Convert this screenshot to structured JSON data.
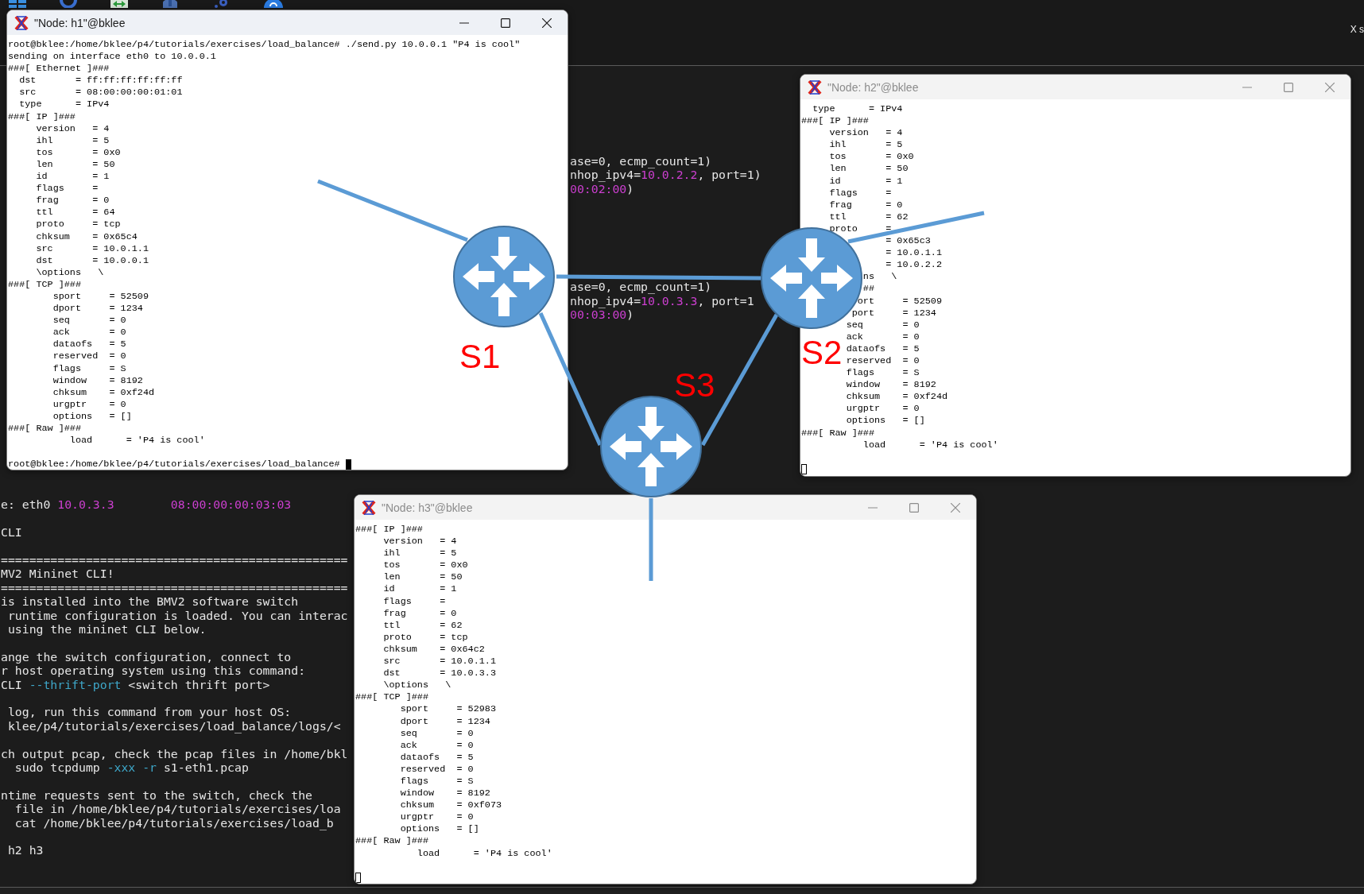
{
  "corner_text": "X s",
  "background_terminal": {
    "middle_blocks": [
      [
        {
          "segments": [
            {
              "text": "ase=0, ecmp_count=1)"
            }
          ]
        },
        {
          "segments": [
            {
              "text": "nhop_ipv4="
            },
            {
              "text": "10.0.2.2",
              "color": "#cc3fd0"
            },
            {
              "text": ", port=1)"
            }
          ]
        },
        {
          "segments": [
            {
              "text": "00:02:00",
              "color": "#cc3fd0"
            },
            {
              "text": ")"
            }
          ]
        }
      ],
      [
        {
          "segments": [
            {
              "text": "ase=0, ecmp_count=1)"
            }
          ]
        },
        {
          "segments": [
            {
              "text": "nhop_ipv4="
            },
            {
              "text": "10.0.3.3",
              "color": "#cc3fd0"
            },
            {
              "text": ", port=1"
            }
          ]
        },
        {
          "segments": [
            {
              "text": "00:03:00",
              "color": "#cc3fd0"
            },
            {
              "text": ")"
            }
          ]
        }
      ]
    ],
    "lower_blocks": [
      [
        {
          "segments": [
            {
              "text": "e: eth0 "
            },
            {
              "text": "10.0.3.3        ",
              "color": "#cc3fd0"
            },
            {
              "text": "08:00:00:00:03:03",
              "color": "#cc3fd0"
            }
          ]
        }
      ],
      [
        {
          "segments": [
            {
              "text": "CLI"
            }
          ]
        }
      ],
      [
        {
          "segments": [
            {
              "text": "================================================="
            }
          ]
        },
        {
          "segments": [
            {
              "text": "MV2 Mininet CLI!"
            }
          ]
        },
        {
          "segments": [
            {
              "text": "================================================="
            }
          ]
        },
        {
          "segments": [
            {
              "text": "is installed into the BMV2 software switch"
            }
          ]
        },
        {
          "segments": [
            {
              "text": " runtime configuration is loaded. You can interac"
            }
          ]
        },
        {
          "segments": [
            {
              "text": " using the mininet CLI below."
            }
          ]
        }
      ],
      [
        {
          "segments": [
            {
              "text": "ange the switch configuration, connect to"
            }
          ]
        },
        {
          "segments": [
            {
              "text": "r host operating system using this command:"
            }
          ]
        },
        {
          "segments": [
            {
              "text": "CLI "
            },
            {
              "text": "--thrift-port",
              "color": "#3ea7c9"
            },
            {
              "text": " <switch thrift port>"
            }
          ]
        }
      ],
      [
        {
          "segments": [
            {
              "text": " log, run this command from your host OS:"
            }
          ]
        },
        {
          "segments": [
            {
              "text": " klee/p4/tutorials/exercises/load_balance/logs/<"
            }
          ]
        }
      ],
      [
        {
          "segments": [
            {
              "text": "ch output pcap, check the pcap files in /home/bkl"
            }
          ]
        },
        {
          "segments": [
            {
              "text": "  sudo tcpdump "
            },
            {
              "text": "-xxx -r",
              "color": "#3ea7c9"
            },
            {
              "text": " s1-eth1.pcap"
            }
          ]
        }
      ],
      [
        {
          "segments": [
            {
              "text": "ntime requests sent to the switch, check the"
            }
          ]
        },
        {
          "segments": [
            {
              "text": "  file in /home/bklee/p4/tutorials/exercises/loa"
            }
          ]
        },
        {
          "segments": [
            {
              "text": "  cat /home/bklee/p4/tutorials/exercises/load_b"
            }
          ]
        }
      ],
      [
        {
          "segments": [
            {
              "text": " h2 h3"
            }
          ]
        }
      ]
    ]
  },
  "windows": [
    {
      "title": "\"Node: h1\"@bklee",
      "active": true,
      "lines": [
        "root@bklee:/home/bklee/p4/tutorials/exercises/load_balance# ./send.py 10.0.0.1 \"P4 is cool\"",
        "sending on interface eth0 to 10.0.0.1"
      ],
      "packet": {
        "header": "###[ Ethernet ]###",
        "fields": [
          {
            "name": "dst",
            "value": "= ff:ff:ff:ff:ff:ff"
          },
          {
            "name": "src",
            "value": "= 08:00:00:00:01:01"
          },
          {
            "name": "type",
            "value": "= IPv4"
          }
        ],
        "payload": {
          "header": "###[ IP ]###",
          "fields": [
            {
              "name": "version",
              "value": "= 4"
            },
            {
              "name": "ihl",
              "value": "= 5"
            },
            {
              "name": "tos",
              "value": "= 0x0"
            },
            {
              "name": "len",
              "value": "= 50"
            },
            {
              "name": "id",
              "value": "= 1"
            },
            {
              "name": "flags",
              "value": "="
            },
            {
              "name": "frag",
              "value": "= 0"
            },
            {
              "name": "ttl",
              "value": "= 64"
            },
            {
              "name": "proto",
              "value": "= tcp"
            },
            {
              "name": "chksum",
              "value": "= 0x65c4"
            },
            {
              "name": "src",
              "value": "= 10.0.1.1"
            },
            {
              "name": "dst",
              "value": "= 10.0.0.1"
            },
            {
              "name": "\\options",
              "value": " \\"
            }
          ],
          "payload": {
            "header": "###[ TCP ]###",
            "fields": [
              {
                "name": "sport",
                "value": "= 52509"
              },
              {
                "name": "dport",
                "value": "= 1234"
              },
              {
                "name": "seq",
                "value": "= 0"
              },
              {
                "name": "ack",
                "value": "= 0"
              },
              {
                "name": "dataofs",
                "value": "= 5"
              },
              {
                "name": "reserved",
                "value": "= 0"
              },
              {
                "name": "flags",
                "value": "= S"
              },
              {
                "name": "window",
                "value": "= 8192"
              },
              {
                "name": "chksum",
                "value": "= 0xf24d"
              },
              {
                "name": "urgptr",
                "value": "= 0"
              },
              {
                "name": "options",
                "value": "= []"
              }
            ],
            "payload": {
              "header": "###[ Raw ]###",
              "fields": [
                {
                  "name": "load",
                  "value": "= 'P4 is cool'"
                }
              ]
            }
          }
        }
      },
      "prompt": "root@bklee:/home/bklee/p4/tutorials/exercises/load_balance#"
    },
    {
      "title": "\"Node: h2\"@bklee",
      "active": false,
      "packet": {
        "fields": [
          {
            "name": "type",
            "value": "= IPv4"
          }
        ],
        "payload": {
          "header": "###[ IP ]###",
          "fields": [
            {
              "name": "version",
              "value": "= 4"
            },
            {
              "name": "ihl",
              "value": "= 5"
            },
            {
              "name": "tos",
              "value": "= 0x0"
            },
            {
              "name": "len",
              "value": "= 50"
            },
            {
              "name": "id",
              "value": "= 1"
            },
            {
              "name": "flags",
              "value": "="
            },
            {
              "name": "frag",
              "value": "= 0"
            },
            {
              "name": "ttl",
              "value": "= 62"
            },
            {
              "name": "proto",
              "value": "="
            },
            {
              "value": "= 0x65c3"
            },
            {
              "value": "= 10.0.1.1"
            },
            {
              "value": "= 10.0.2.2"
            },
            {
              "name_end": "ns",
              "value": " \\"
            }
          ],
          "payload": {
            "header_end": "##",
            "fields": [
              {
                "name_end": "ort",
                "value": "= 52509"
              },
              {
                "name_end": "port",
                "value": "= 1234"
              },
              {
                "name": "seq",
                "value": "= 0"
              },
              {
                "name": "ack",
                "value": "= 0"
              },
              {
                "name": "dataofs",
                "value": "= 5"
              },
              {
                "name": "reserved",
                "value": "= 0"
              },
              {
                "name": "flags",
                "value": "= S"
              },
              {
                "name": "window",
                "value": "= 8192"
              },
              {
                "name": "chksum",
                "value": "= 0xf24d"
              },
              {
                "name": "urgptr",
                "value": "= 0"
              },
              {
                "name": "options",
                "value": "= []"
              }
            ],
            "payload": {
              "header": "###[ Raw ]###",
              "fields": [
                {
                  "name": "load",
                  "value": "= 'P4 is cool'"
                }
              ]
            }
          }
        }
      }
    },
    {
      "title": "\"Node: h3\"@bklee",
      "active": false,
      "packet": {
        "payload": {
          "header": "###[ IP ]###",
          "fields": [
            {
              "name": "version",
              "value": "= 4"
            },
            {
              "name": "ihl",
              "value": "= 5"
            },
            {
              "name": "tos",
              "value": "= 0x0"
            },
            {
              "name": "len",
              "value": "= 50"
            },
            {
              "name": "id",
              "value": "= 1"
            },
            {
              "name": "flags",
              "value": "="
            },
            {
              "name": "frag",
              "value": "= 0"
            },
            {
              "name": "ttl",
              "value": "= 62"
            },
            {
              "name": "proto",
              "value": "= tcp"
            },
            {
              "name": "chksum",
              "value": "= 0x64c2"
            },
            {
              "name": "src",
              "value": "= 10.0.1.1"
            },
            {
              "name": "dst",
              "value": "= 10.0.3.3"
            },
            {
              "name": "\\options",
              "value": " \\"
            }
          ],
          "payload": {
            "header": "###[ TCP ]###",
            "fields": [
              {
                "name": "sport",
                "value": "= 52983"
              },
              {
                "name": "dport",
                "value": "= 1234"
              },
              {
                "name": "seq",
                "value": "= 0"
              },
              {
                "name": "ack",
                "value": "= 0"
              },
              {
                "name": "dataofs",
                "value": "= 5"
              },
              {
                "name": "reserved",
                "value": "= 0"
              },
              {
                "name": "flags",
                "value": "= S"
              },
              {
                "name": "window",
                "value": "= 8192"
              },
              {
                "name": "chksum",
                "value": "= 0xf073"
              },
              {
                "name": "urgptr",
                "value": "= 0"
              },
              {
                "name": "options",
                "value": "= []"
              }
            ],
            "payload": {
              "header": "###[ Raw ]###",
              "fields": [
                {
                  "name": "load",
                  "value": "= 'P4 is cool'"
                }
              ]
            }
          }
        }
      }
    }
  ],
  "diagram": {
    "nodes": [
      {
        "label": "S1"
      },
      {
        "label": "S2"
      },
      {
        "label": "S3"
      }
    ]
  }
}
